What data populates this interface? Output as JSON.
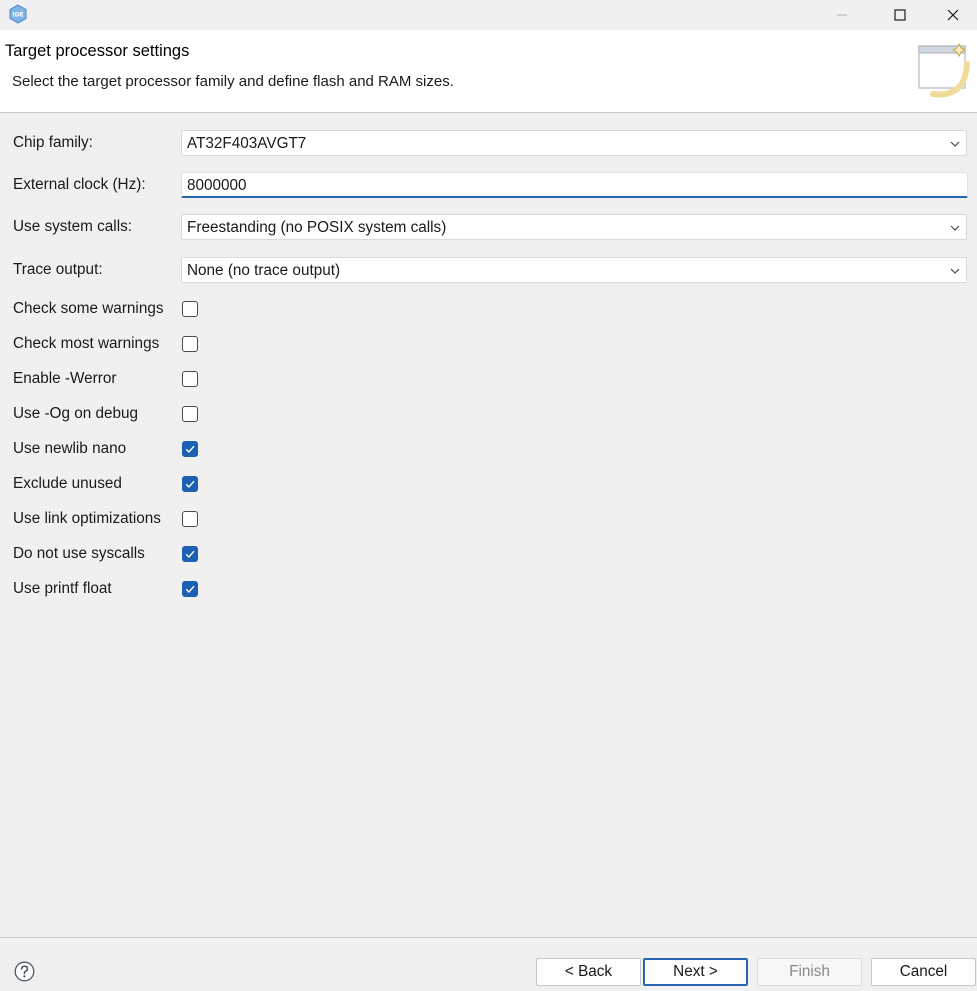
{
  "window": {
    "app_icon": "ide-icon",
    "controls": [
      "minimize-icon",
      "maximize-icon",
      "close-icon"
    ]
  },
  "header": {
    "title": "Target processor settings",
    "description": "Select the target processor family and define flash and RAM sizes."
  },
  "form": {
    "chip_family": {
      "label": "Chip family:",
      "value": "AT32F403AVGT7"
    },
    "external_clock": {
      "label": "External clock (Hz):",
      "value": "8000000"
    },
    "system_calls": {
      "label": "Use system calls:",
      "value": "Freestanding (no POSIX system calls)"
    },
    "trace_output": {
      "label": "Trace output:",
      "value": "None (no trace output)"
    },
    "checkboxes": [
      {
        "label": "Check some warnings",
        "checked": false
      },
      {
        "label": "Check most warnings",
        "checked": false
      },
      {
        "label": "Enable -Werror",
        "checked": false
      },
      {
        "label": "Use -Og on debug",
        "checked": false
      },
      {
        "label": "Use newlib nano",
        "checked": true
      },
      {
        "label": "Exclude unused",
        "checked": true
      },
      {
        "label": "Use link optimizations",
        "checked": false
      },
      {
        "label": "Do not use syscalls",
        "checked": true
      },
      {
        "label": "Use printf float",
        "checked": true
      }
    ]
  },
  "footer": {
    "help_icon": "help-icon",
    "back": "< Back",
    "next": "Next >",
    "finish": "Finish",
    "cancel": "Cancel"
  },
  "colors": {
    "accent": "#1d5fb0",
    "background": "#f0f0f0"
  }
}
